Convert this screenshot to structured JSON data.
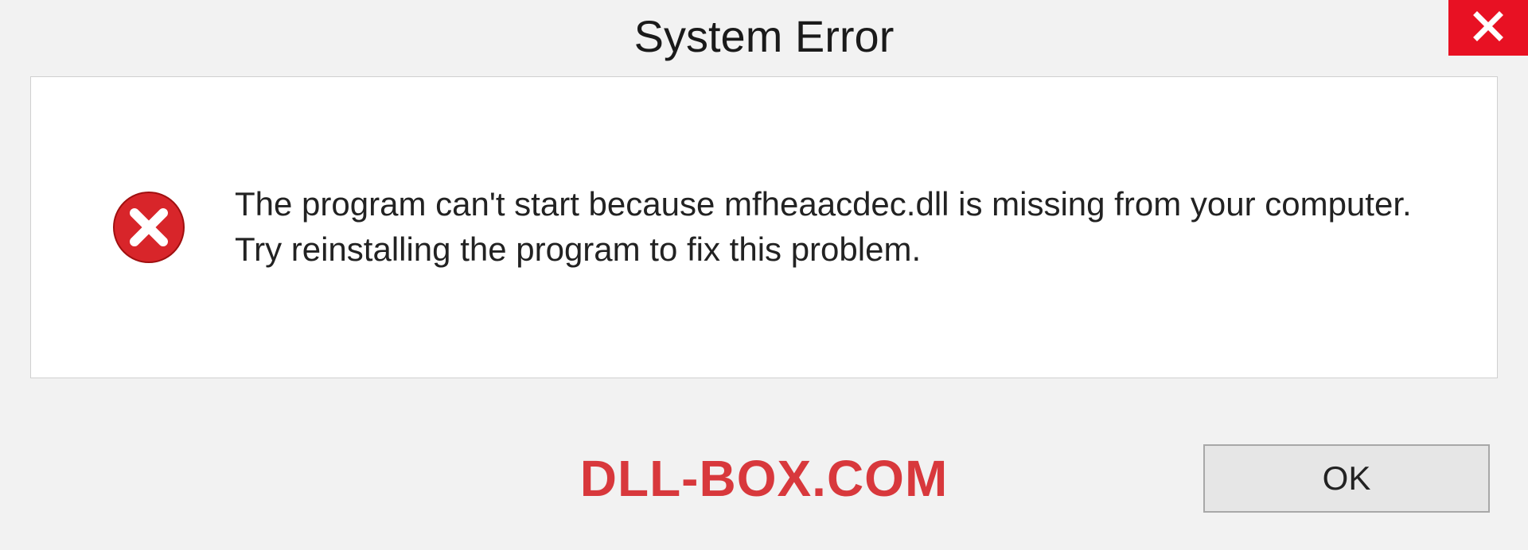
{
  "dialog": {
    "title": "System Error",
    "message": "The program can't start because mfheaacdec.dll is missing from your computer. Try reinstalling the program to fix this problem.",
    "ok_label": "OK"
  },
  "watermark": "DLL-BOX.COM",
  "colors": {
    "close_bg": "#e81123",
    "error_icon": "#d8252a",
    "watermark": "#d8383c"
  }
}
